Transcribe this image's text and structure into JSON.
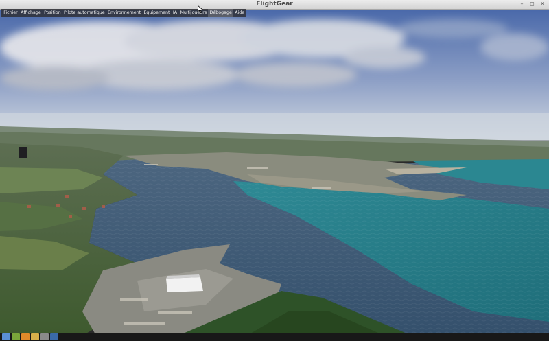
{
  "window": {
    "title": "FlightGear",
    "buttons": [
      "–",
      "◻",
      "✕"
    ]
  },
  "menubar": {
    "items": [
      {
        "label": "Fichier",
        "active": false
      },
      {
        "label": "Affichage",
        "active": false
      },
      {
        "label": "Position",
        "active": false
      },
      {
        "label": "Pilote automatique",
        "active": false
      },
      {
        "label": "Environnement",
        "active": false
      },
      {
        "label": "Equipement",
        "active": false
      },
      {
        "label": "IA",
        "active": false
      },
      {
        "label": "Multijoueurs",
        "active": false
      },
      {
        "label": "Débogage",
        "active": true
      },
      {
        "label": "Aide",
        "active": false
      }
    ]
  },
  "taskbar": {
    "icons": [
      {
        "name": "app-launcher-icon",
        "color": "#5a8fd4"
      },
      {
        "name": "files-icon",
        "color": "#7aa63a"
      },
      {
        "name": "browser-icon",
        "color": "#e08a2a"
      },
      {
        "name": "folder-icon",
        "color": "#d8b04a"
      },
      {
        "name": "terminal-icon",
        "color": "#8a8a8a"
      },
      {
        "name": "flightgear-icon",
        "color": "#3a6aa8"
      }
    ]
  },
  "colors": {
    "sky_top": "#4f6fae",
    "sky_horizon": "#c8d2dc",
    "water_dark": "#3a5470",
    "water_teal": "#2a8a92",
    "land_green": "#4d6a38"
  }
}
